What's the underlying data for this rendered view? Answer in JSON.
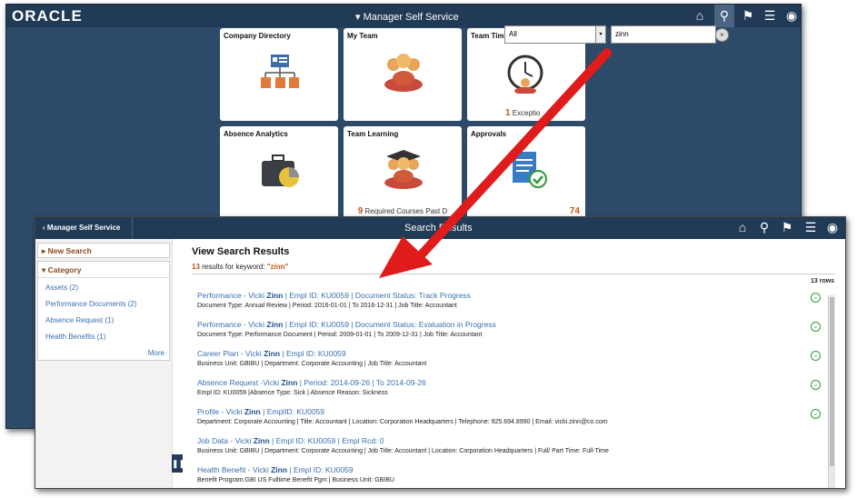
{
  "back_window": {
    "logo": "ORACLE",
    "title": "▾ Manager Self Service",
    "search": {
      "category": "All",
      "query": "zinn"
    },
    "tiles": [
      {
        "label": "Company Directory",
        "footer_count": "",
        "footer_text": "",
        "badge": ""
      },
      {
        "label": "My Team",
        "footer_count": "",
        "footer_text": "",
        "badge": ""
      },
      {
        "label": "Team Tim",
        "footer_count": "1",
        "footer_text": "Exceptio",
        "badge": ""
      },
      {
        "label": "Absence Analytics",
        "footer_count": "",
        "footer_text": "",
        "badge": ""
      },
      {
        "label": "Team Learning",
        "footer_count": "9",
        "footer_text": "Required Courses Past D",
        "badge": ""
      },
      {
        "label": "Approvals",
        "footer_count": "",
        "footer_text": "",
        "badge": "74"
      }
    ]
  },
  "front_window": {
    "back_label": "Manager Self Service",
    "title": "Search Results",
    "sidebar": {
      "new_search": "New Search",
      "category": "Category",
      "items": [
        "Assets (2)",
        "Performance Documents (2)",
        "Absence Request (1)",
        "Health Benefits (1)"
      ],
      "more": "More"
    },
    "results": {
      "heading": "View Search Results",
      "count": "13",
      "summary": "results for keyword:",
      "keyword": "\"zinn\"",
      "rows_label": "13 rows",
      "items": [
        {
          "pre": "Performance - Vicki ",
          "hl": "Zinn",
          "post": " | Empl ID: KU0059 | Document Status: Track Progress",
          "detail": "Document Type: Annual Review | Period: 2016-01-01 | To 2016-12-31 | Job Title: Accountant"
        },
        {
          "pre": "Performance - Vicki ",
          "hl": "Zinn",
          "post": " | Empl ID: KU0059 | Document Status: Evaluation in Progress",
          "detail": "Document Type: Performance Document | Period: 2009-01-01 | To 2009-12-31 | Job Title: Accountant"
        },
        {
          "pre": "Career Plan - Vicki ",
          "hl": "Zinn",
          "post": " | Empl ID: KU0059",
          "detail": "Business Unit: GBIBU | Department: Corporate Accounting | Job Title: Accountant"
        },
        {
          "pre": "Absence Request -Vicki ",
          "hl": "Zinn",
          "post": " | Period: 2014-09-26 | To 2014-09-26",
          "detail": "Empl ID: KU0059 |Absence Type: Sick | Absence Reason: Sickness"
        },
        {
          "pre": "Profile - Vicki ",
          "hl": "Zinn",
          "post": " | EmplID: KU0059",
          "detail": "Department: Corporate Accounting | Title: Accountant | Location: Corporation Headquarters | Telephone: 925.694.8990 | Email: vicki.zinn@co.com"
        },
        {
          "pre": "Job Data - Vicki ",
          "hl": "Zinn",
          "post": " | Empl ID: KU0059 | Empl Rcd: 0",
          "detail": "Business Unit: GBIBU | Department: Corporate Accounting | Job Title: Accountant | Location: Corporation Headquarters | Full/ Part Time: Full-Time"
        },
        {
          "pre": "Health Benefit - Vicki ",
          "hl": "Zinn",
          "post": " | Empl ID: KU0059",
          "detail": "Benefit Program:GBI US Fulltime Benefit Pgm | Business Unit: GBIBU"
        }
      ]
    }
  },
  "colors": {
    "arrow": "#e01b1b",
    "header": "#213a55",
    "accent": "#c0571c",
    "link": "#3a6fb0"
  }
}
